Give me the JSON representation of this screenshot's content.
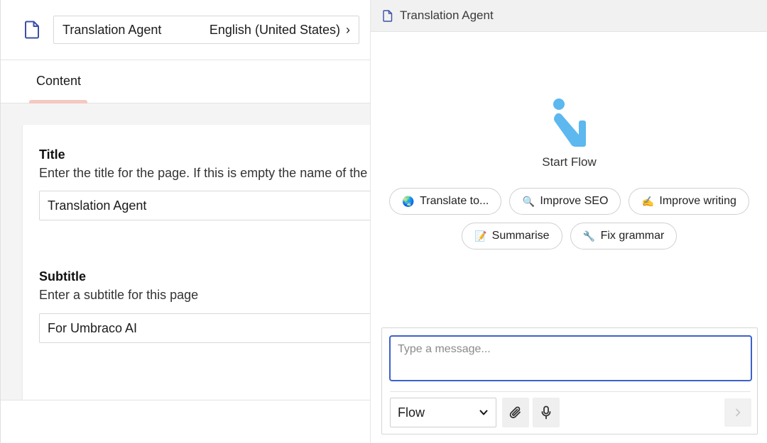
{
  "editor": {
    "doc_name": "Translation Agent",
    "culture": "English (United States)",
    "tabs": [
      {
        "label": "Content"
      }
    ],
    "properties": [
      {
        "label": "Title",
        "description": "Enter the title for the page. If this is empty the name of the pa",
        "value": "Translation Agent"
      },
      {
        "label": "Subtitle",
        "description": "Enter a subtitle for this page",
        "value": "For Umbraco AI"
      }
    ]
  },
  "chat": {
    "header_title": "Translation Agent",
    "start_label": "Start Flow",
    "chips": [
      {
        "emoji": "🌏",
        "label": "Translate to..."
      },
      {
        "emoji": "🔍",
        "label": "Improve SEO"
      },
      {
        "emoji": "✍️",
        "label": "Improve writing"
      },
      {
        "emoji": "📝",
        "label": "Summarise"
      },
      {
        "emoji": "🔧",
        "label": "Fix grammar"
      }
    ],
    "input_placeholder": "Type a message...",
    "mode": "Flow",
    "colors": {
      "accent": "#3c61c9",
      "logo": "#5cb8ee",
      "tab_underline": "#f3c9c1"
    }
  }
}
